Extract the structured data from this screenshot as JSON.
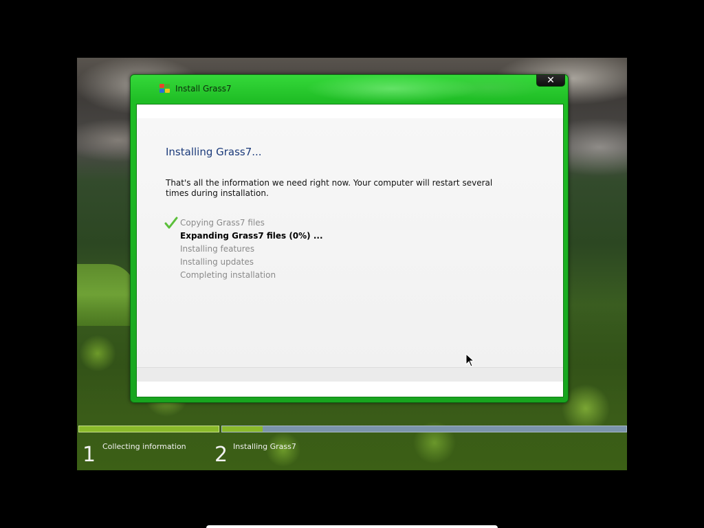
{
  "window": {
    "title": "Install Grass7",
    "close_label": "✕"
  },
  "main": {
    "heading": "Installing Grass7...",
    "info": "That's all the information we need right now. Your computer will restart several times during installation.",
    "steps": [
      {
        "label": "Copying Grass7 files",
        "status": "done"
      },
      {
        "label": "Expanding Grass7 files (0%) ...",
        "status": "current"
      },
      {
        "label": "Installing features",
        "status": "pending"
      },
      {
        "label": "Installing updates",
        "status": "pending"
      },
      {
        "label": "Completing installation",
        "status": "pending"
      }
    ]
  },
  "progress": {
    "stages": [
      {
        "number": "1",
        "label": "Collecting information",
        "fraction": 1.0
      },
      {
        "number": "2",
        "label": "Installing Grass7",
        "fraction": 0.1
      }
    ]
  },
  "colors": {
    "window_accent": "#1fbd25",
    "progress_done": "#8aba2a",
    "progress_pending": "#7b94aa",
    "heading": "#1b3a7a"
  },
  "icons": {
    "logo": "grass7-logo-icon",
    "check": "checkmark-icon",
    "cursor": "mouse-cursor-icon"
  }
}
